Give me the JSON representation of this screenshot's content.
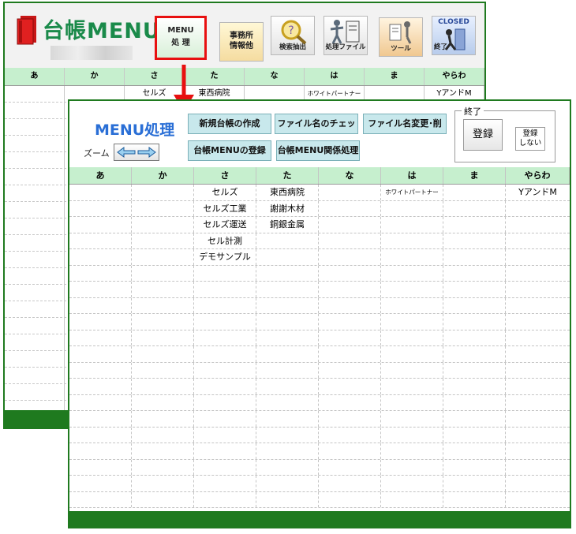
{
  "back_window": {
    "title": "台帳MENU",
    "toolbar": {
      "menu_line1": "MENU",
      "menu_line2": "処 理",
      "office_line1": "事務所",
      "office_line2": "情報他",
      "search_label": "検索抽出",
      "process_label": "処理ファイル",
      "tool_label": "ツール",
      "closed_top": "CLOSED",
      "closed_label": "終了"
    },
    "columns": [
      "あ",
      "か",
      "さ",
      "た",
      "な",
      "は",
      "ま",
      "やらわ"
    ],
    "first_row": [
      "",
      "",
      "セルズ",
      "東西病院",
      "",
      "ホワイトパートナー",
      "",
      "YアンドM"
    ]
  },
  "front_window": {
    "title": "MENU処理",
    "zoom_label": "ズーム",
    "buttons": {
      "new_ledger": "新規台帳の作成",
      "file_name_check": "ファイル名のチェッ",
      "file_rename_delete": "ファイル名変更･削",
      "register_menu": "台帳MENUの登録",
      "menu_related": "台帳MENU関係処理"
    },
    "end_group": {
      "label": "終了",
      "register": "登録",
      "no_register_line1": "登録",
      "no_register_line2": "しない"
    },
    "columns": [
      "あ",
      "か",
      "さ",
      "た",
      "な",
      "は",
      "ま",
      "やらわ"
    ],
    "rows": [
      [
        "",
        "",
        "セルズ",
        "東西病院",
        "",
        "ホワイトパートナー",
        "",
        "YアンドM"
      ],
      [
        "",
        "",
        "セルズ工業",
        "謝謝木材",
        "",
        "",
        "",
        ""
      ],
      [
        "",
        "",
        "セルズ運送",
        "銅銀金属",
        "",
        "",
        "",
        ""
      ],
      [
        "",
        "",
        "セル計測",
        "",
        "",
        "",
        "",
        ""
      ],
      [
        "",
        "",
        "デモサンプル",
        "",
        "",
        "",
        "",
        ""
      ]
    ]
  },
  "colors": {
    "frame_green": "#1f7a1f",
    "header_green": "#c6efce",
    "title_blue": "#2a6fd6",
    "highlight_red": "#e81010",
    "button_teal": "#c8e8ec"
  }
}
